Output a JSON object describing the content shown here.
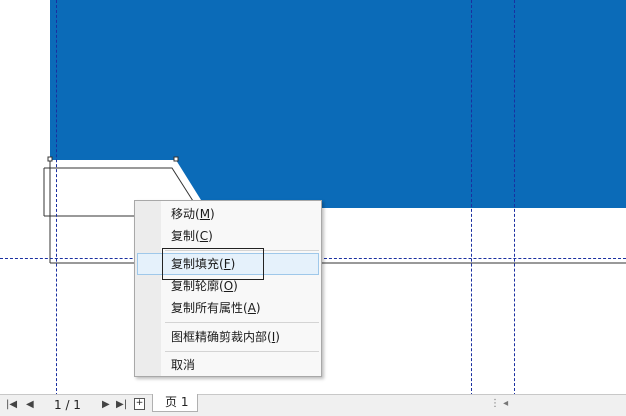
{
  "context_menu": {
    "items": [
      {
        "label": "移动(",
        "key": "M",
        "tail": ")"
      },
      {
        "label": "复制(",
        "key": "C",
        "tail": ")"
      },
      {
        "label": "复制填充(",
        "key": "F",
        "tail": ")"
      },
      {
        "label": "复制轮廓(",
        "key": "O",
        "tail": ")"
      },
      {
        "label": "复制所有属性(",
        "key": "A",
        "tail": ")"
      },
      {
        "label": "图框精确剪裁内部(",
        "key": "I",
        "tail": ")"
      },
      {
        "label": "取消",
        "key": "",
        "tail": ""
      }
    ],
    "highlighted_index": 2
  },
  "status_bar": {
    "page_count": "1 / 1",
    "page_tab": "页 1"
  },
  "colors": {
    "fill_blue": "#0b6bb8",
    "guide": "#1a2fa0"
  }
}
